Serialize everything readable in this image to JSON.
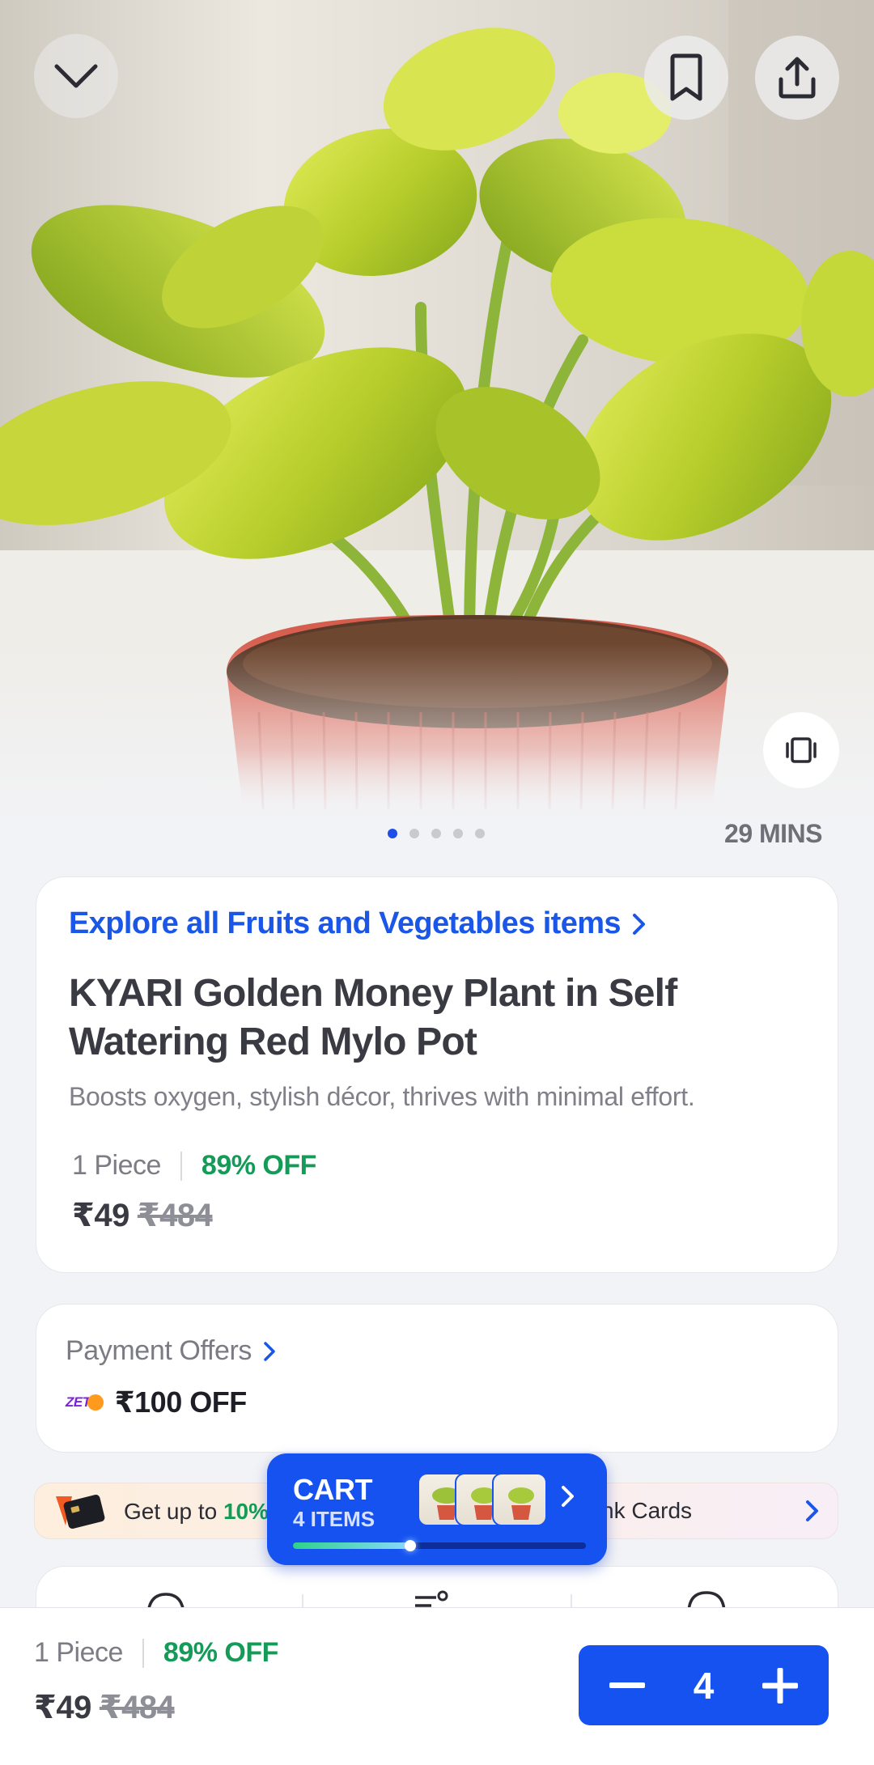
{
  "hero": {
    "eta": "29 MINS",
    "image_count": 5,
    "active_image": 1
  },
  "product": {
    "category_link": "Explore all Fruits and Vegetables items",
    "title": "KYARI Golden Money Plant in Self Watering Red Mylo Pot",
    "description": "Boosts oxygen, stylish décor, thrives with minimal effort.",
    "quantity": "1 Piece",
    "discount": "89% OFF",
    "price": "₹49",
    "mrp": "₹484"
  },
  "payment": {
    "title": "Payment Offers",
    "brand": "ZET",
    "offer": "₹100 OFF"
  },
  "bank_banner": {
    "text_prefix": "Get up to",
    "highlight": "10%",
    "text_suffix": "nk Cards"
  },
  "cart": {
    "title": "CART",
    "count": "4 ITEMS",
    "progress": 0.4
  },
  "bottom_bar": {
    "quantity": "1 Piece",
    "discount": "89% OFF",
    "price": "₹49",
    "mrp": "₹484",
    "stepper_value": "4"
  },
  "icons": {
    "back": "chevron-down-icon",
    "bookmark": "bookmark-icon",
    "share": "share-icon",
    "ar": "ar-view-icon"
  },
  "colors": {
    "accent": "#1652f0",
    "link": "#1a56e8",
    "discount": "#139b57"
  }
}
